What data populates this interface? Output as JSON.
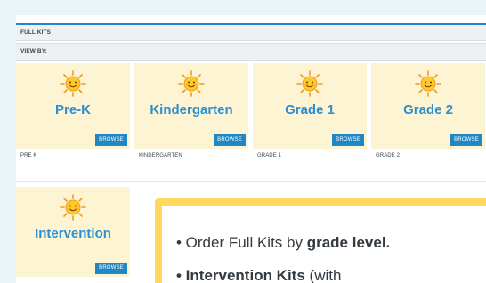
{
  "header": {
    "title": "FULL KITS",
    "view_by": "VIEW BY:"
  },
  "tiles": [
    {
      "title": "Pre-K",
      "browse": "BROWSE",
      "label": "PRE K"
    },
    {
      "title": "Kindergarten",
      "browse": "BROWSE",
      "label": "KINDERGARTEN"
    },
    {
      "title": "Grade 1",
      "browse": "BROWSE",
      "label": "GRADE 1"
    },
    {
      "title": "Grade 2",
      "browse": "BROWSE",
      "label": "GRADE 2"
    },
    {
      "title": "Intervention",
      "browse": "BROWSE"
    }
  ],
  "callout": {
    "line1_prefix": "• Order Full Kits by ",
    "line1_bold": "grade level.",
    "line2_bold": "• Intervention Kits",
    "line2_suffix": " (with"
  },
  "colors": {
    "accent": "#1f87c4",
    "title_blue": "#2b8fd0",
    "tile_bg": "#fdf4d4",
    "callout_border": "#ffd85e"
  },
  "icons": {
    "tile_icon": "smiling-sun-icon"
  }
}
